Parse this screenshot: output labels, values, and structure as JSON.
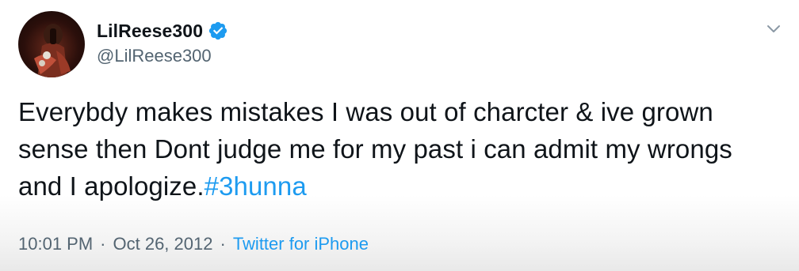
{
  "tweet": {
    "display_name": "LilReese300",
    "handle": "@LilReese300",
    "verified": true,
    "text_main": "Everybdy makes mistakes I was out of charcter & ive grown sense then Dont judge me for my past i can admit my wrongs and I apologize.",
    "hashtag": "#3hunna",
    "time": "10:01 PM",
    "separator": "·",
    "date": "Oct 26, 2012",
    "source": "Twitter for iPhone"
  },
  "icons": {
    "avatar": "profile-photo",
    "verified": "verified-badge-icon",
    "menu": "chevron-down-icon"
  },
  "colors": {
    "link": "#1d9bf0",
    "verified": "#1d9bf0",
    "text": "#0f1419",
    "secondary": "#536471"
  }
}
